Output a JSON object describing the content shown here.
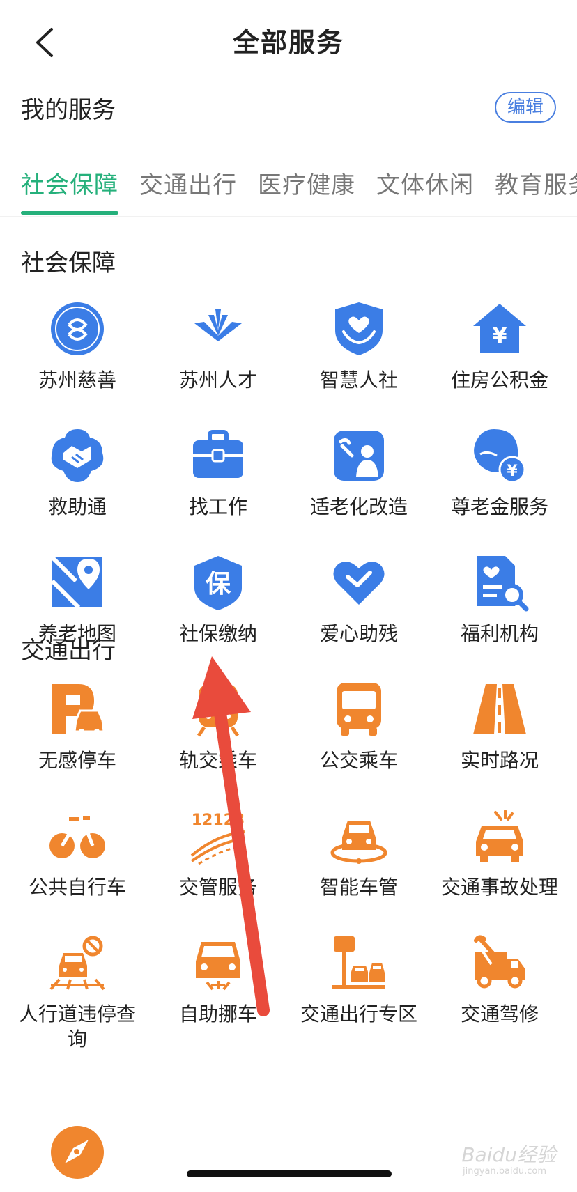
{
  "header": {
    "title": "全部服务"
  },
  "my_services": {
    "label": "我的服务",
    "edit_label": "编辑"
  },
  "tabs": [
    {
      "label": "社会保障",
      "active": true
    },
    {
      "label": "交通出行",
      "active": false
    },
    {
      "label": "医疗健康",
      "active": false
    },
    {
      "label": "文体休闲",
      "active": false
    },
    {
      "label": "教育服务",
      "active": false
    }
  ],
  "sections": {
    "social": {
      "title": "社会保障",
      "color": "#3b7de6",
      "items": [
        {
          "label": "苏州慈善",
          "icon": "charity-logo-icon"
        },
        {
          "label": "苏州人才",
          "icon": "talent-logo-icon"
        },
        {
          "label": "智慧人社",
          "icon": "shield-heart-hands-icon"
        },
        {
          "label": "住房公积金",
          "icon": "house-yen-icon"
        },
        {
          "label": "救助通",
          "icon": "handshake-badge-icon"
        },
        {
          "label": "找工作",
          "icon": "briefcase-icon"
        },
        {
          "label": "适老化改造",
          "icon": "elderly-repair-icon"
        },
        {
          "label": "尊老金服务",
          "icon": "elder-yen-icon"
        },
        {
          "label": "养老地图",
          "icon": "map-pin-icon"
        },
        {
          "label": "社保缴纳",
          "icon": "shield-bao-icon"
        },
        {
          "label": "爱心助残",
          "icon": "heart-handshake-icon"
        },
        {
          "label": "福利机构",
          "icon": "document-search-icon"
        }
      ]
    },
    "traffic": {
      "title": "交通出行",
      "color": "#f0862e",
      "items": [
        {
          "label": "无感停车",
          "icon": "parking-car-icon"
        },
        {
          "label": "轨交乘车",
          "icon": "metro-train-icon"
        },
        {
          "label": "公交乘车",
          "icon": "bus-icon"
        },
        {
          "label": "实时路况",
          "icon": "road-icon"
        },
        {
          "label": "公共自行车",
          "icon": "bicycle-icon"
        },
        {
          "label": "交管服务",
          "icon": "traffic-12123-icon",
          "icon_text": "12123"
        },
        {
          "label": "智能车管",
          "icon": "car-ring-icon"
        },
        {
          "label": "交通事故处理",
          "icon": "car-accident-icon"
        },
        {
          "label": "人行道违停查询",
          "icon": "no-parking-car-icon"
        },
        {
          "label": "自助挪车",
          "icon": "car-move-icon"
        },
        {
          "label": "交通出行专区",
          "icon": "parking-sign-cars-icon"
        },
        {
          "label": "交通驾修",
          "icon": "truck-wrench-icon"
        },
        {
          "label": "",
          "icon": "compass-icon"
        }
      ]
    }
  },
  "watermark": {
    "text": "Baidu经验",
    "sub": "jingyan.baidu.com"
  }
}
